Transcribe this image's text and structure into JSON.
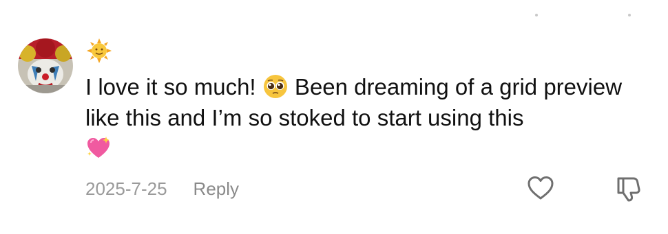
{
  "comment": {
    "username_emoji": "sun-with-face-emoji",
    "text_part1": "I love it so much! ",
    "inline_emoji_1": "pleading-face-emoji",
    "text_part2": " Been dreaming of a grid preview like this and I’m so stoked to start using this",
    "trailing_emoji": "sparkling-heart-emoji",
    "date": "2025-7-25",
    "reply_label": "Reply"
  },
  "actions": {
    "like_icon": "heart-outline-icon",
    "dislike_icon": "thumbs-down-icon"
  },
  "colors": {
    "text": "#111111",
    "meta": "#9a9a9a",
    "icon_stroke": "#6f6f6f"
  }
}
